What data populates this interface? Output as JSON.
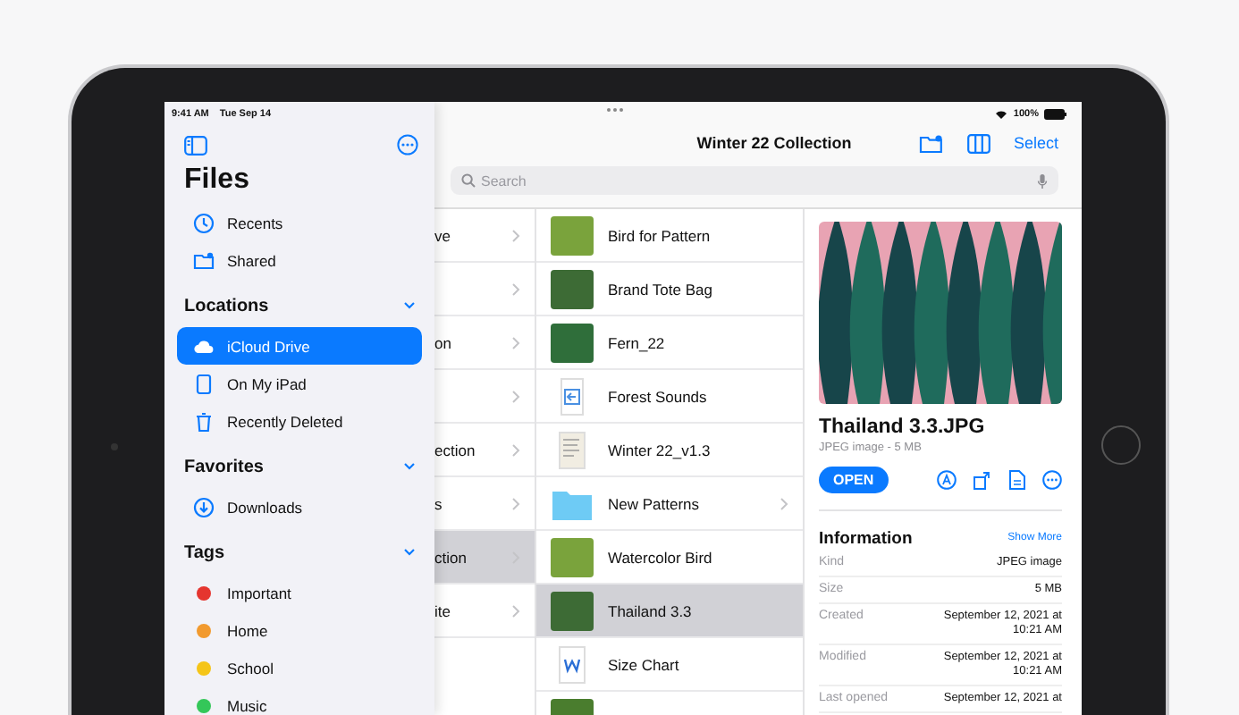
{
  "status_bar": {
    "time": "9:41 AM",
    "date": "Tue Sep 14",
    "battery": "100%"
  },
  "sidebar": {
    "title": "Files",
    "sections": [
      {
        "items": [
          {
            "label": "Recents",
            "kind": "place",
            "selected": false
          },
          {
            "label": "Shared",
            "kind": "place",
            "selected": false
          }
        ]
      },
      {
        "heading": "Locations",
        "expanded": true,
        "items": [
          {
            "label": "iCloud Drive",
            "kind": "place",
            "selected": true
          },
          {
            "label": "On My iPad",
            "kind": "place",
            "selected": false
          },
          {
            "label": "Recently Deleted",
            "kind": "place",
            "selected": false
          }
        ]
      },
      {
        "heading": "Favorites",
        "expanded": true,
        "items": [
          {
            "label": "Downloads",
            "kind": "place",
            "selected": false
          }
        ]
      },
      {
        "heading": "Tags",
        "expanded": true,
        "items": [
          {
            "label": "Important",
            "kind": "tag",
            "color": "#e5352f",
            "selected": false
          },
          {
            "label": "Home",
            "kind": "tag",
            "color": "#f29a2e",
            "selected": false
          },
          {
            "label": "School",
            "kind": "tag",
            "color": "#f5c518",
            "selected": false
          },
          {
            "label": "Music",
            "kind": "tag",
            "color": "#34c759",
            "selected": false
          }
        ]
      }
    ]
  },
  "toolbar": {
    "title": "Winter 22 Collection",
    "select": "Select",
    "search": {
      "placeholder": "Search"
    }
  },
  "column_1": [
    {
      "text": "ve",
      "selected": false
    },
    {
      "selected": false
    },
    {
      "text": "on",
      "selected": false
    },
    {
      "selected": false
    },
    {
      "text": "ection",
      "selected": false
    },
    {
      "text": "s",
      "selected": false
    },
    {
      "text": "ction",
      "selected": true
    },
    {
      "text": "ite",
      "selected": false
    }
  ],
  "files": [
    {
      "name": "Bird for Pattern",
      "kind": "image",
      "selected": false
    },
    {
      "name": "Brand Tote Bag",
      "kind": "image",
      "selected": false
    },
    {
      "name": "Fern_22",
      "kind": "image",
      "selected": false
    },
    {
      "name": "Forest Sounds",
      "kind": "audio",
      "selected": false
    },
    {
      "name": "Winter 22_v1.3",
      "kind": "document",
      "selected": false
    },
    {
      "name": "New Patterns",
      "kind": "folder",
      "selected": false
    },
    {
      "name": "Watercolor Bird",
      "kind": "image",
      "selected": false
    },
    {
      "name": "Thailand 3.3",
      "kind": "image",
      "selected": true
    },
    {
      "name": "Size Chart",
      "kind": "word",
      "selected": false
    },
    {
      "kind": "image",
      "selected": false
    }
  ],
  "detail": {
    "filename": "Thailand 3.3.JPG",
    "subtitle": "JPEG image - 5 MB",
    "open": "OPEN",
    "info_heading": "Information",
    "show_more": "Show More",
    "rows": [
      {
        "label": "Kind",
        "value": "JPEG image"
      },
      {
        "label": "Size",
        "value": "5 MB"
      },
      {
        "label": "Created",
        "value": "September 12, 2021 at 10:21 AM"
      },
      {
        "label": "Modified",
        "value": "September 12, 2021 at 10:21 AM"
      },
      {
        "label": "Last opened",
        "value": "September 12, 2021 at"
      }
    ]
  }
}
